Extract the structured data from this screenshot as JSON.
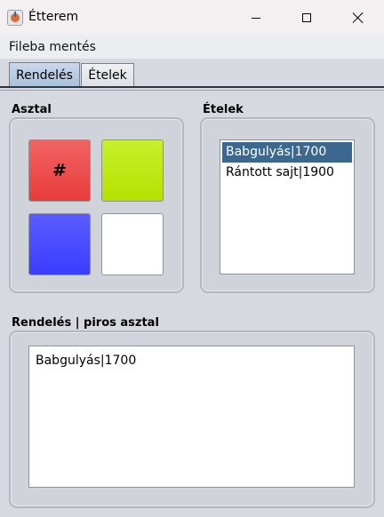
{
  "window": {
    "title": "Étterem"
  },
  "menu": {
    "items": [
      "Fileba mentés"
    ]
  },
  "tabs": [
    {
      "label": "Rendelés",
      "active": true
    },
    {
      "label": "Ételek",
      "active": false
    }
  ],
  "table_panel": {
    "label": "Asztal",
    "buttons": [
      {
        "color": "#e93b3b",
        "text": "#"
      },
      {
        "color": "#b6e000",
        "text": ""
      },
      {
        "color": "#3b3dff",
        "text": ""
      },
      {
        "color": "#ffffff",
        "text": ""
      }
    ]
  },
  "food_panel": {
    "label": "Ételek",
    "items": [
      "Babgulyás|1700",
      "Rántott sajt|1900"
    ],
    "selected_index": 0
  },
  "order_panel": {
    "label": "Rendelés | piros asztal",
    "lines": [
      "Babgulyás|1700"
    ]
  },
  "colors": {
    "selection": "#3c6890",
    "tab_active": "#a8c0dc"
  }
}
